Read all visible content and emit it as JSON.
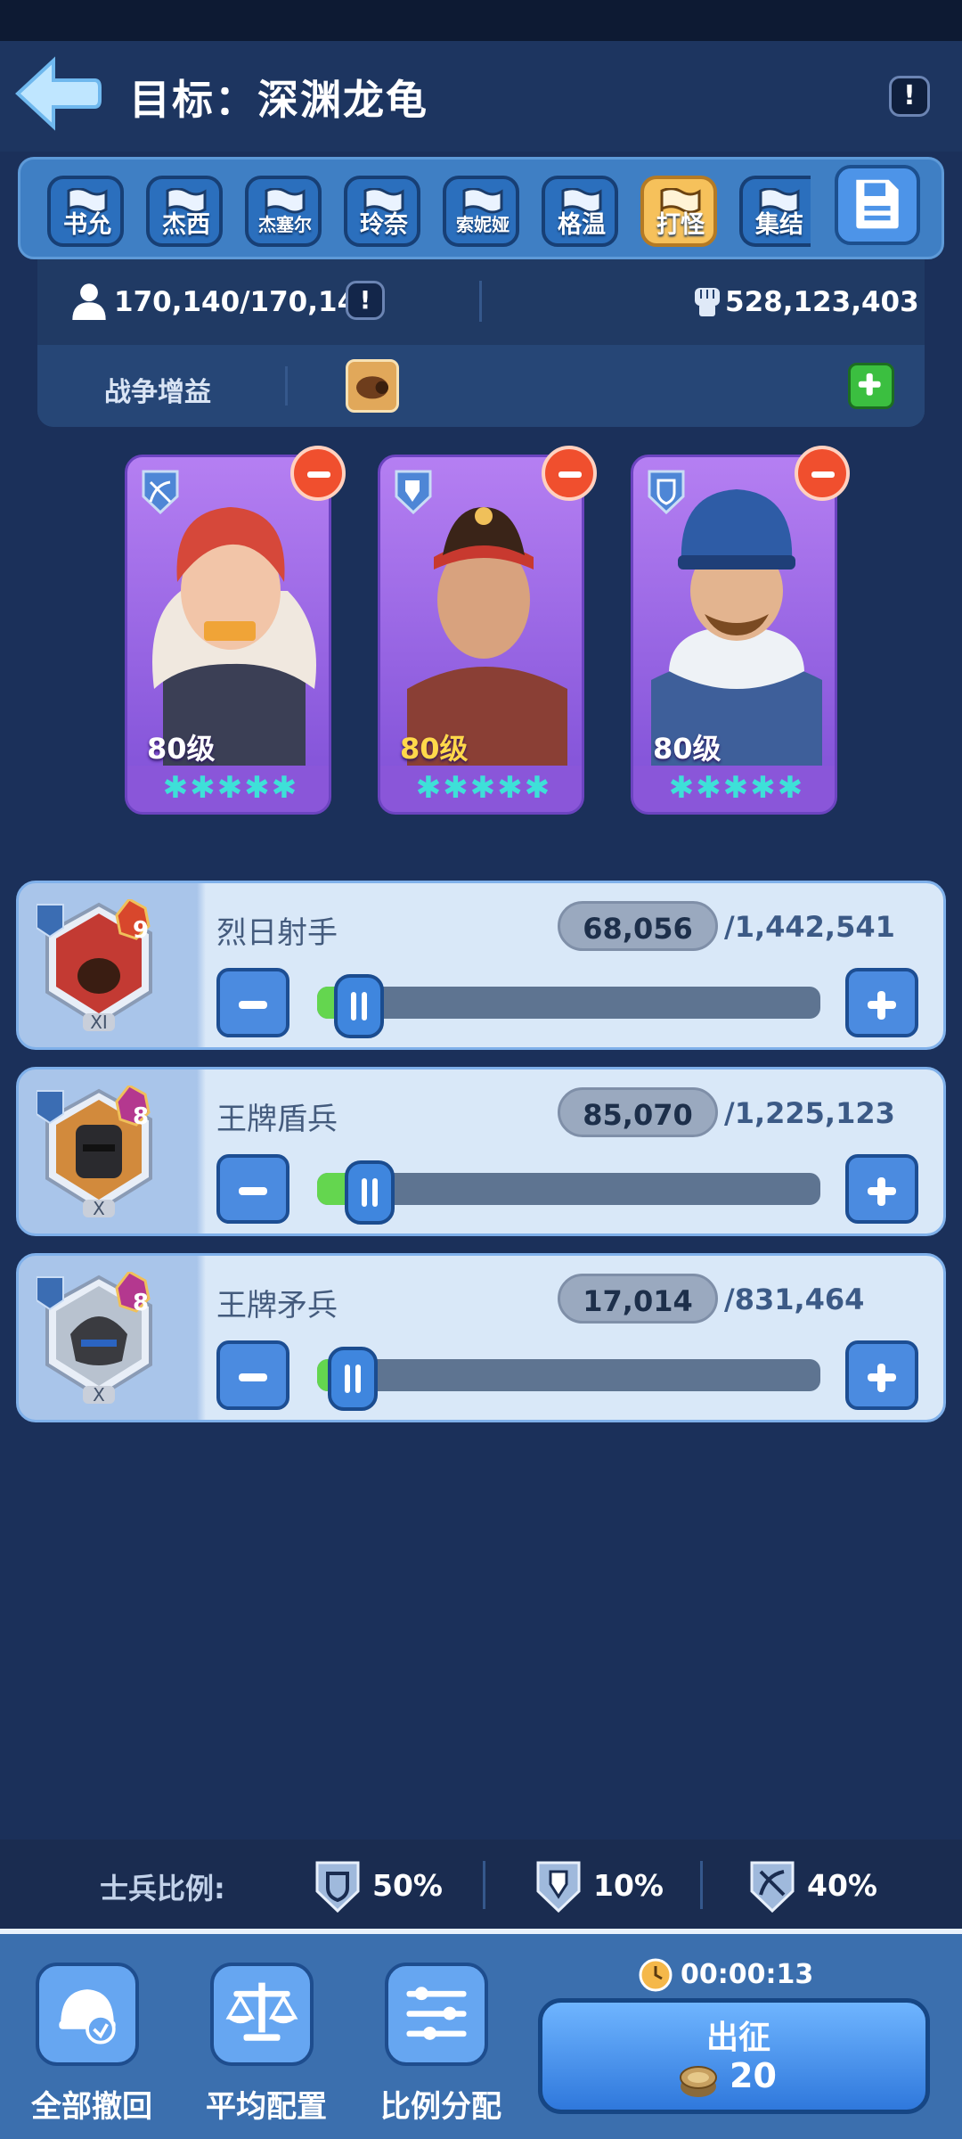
{
  "header": {
    "title": "目标：深渊龙龟",
    "info_icon": "exclamation-icon"
  },
  "presets": [
    {
      "label": "书允",
      "active": false
    },
    {
      "label": "杰西",
      "active": false
    },
    {
      "label": "杰塞尔",
      "active": false
    },
    {
      "label": "玲奈",
      "active": false
    },
    {
      "label": "索妮娅",
      "active": false
    },
    {
      "label": "格温",
      "active": false
    },
    {
      "label": "打怪",
      "active": true
    },
    {
      "label": "集结",
      "active": false
    }
  ],
  "stats": {
    "troops": "170,140/170,140",
    "power": "528,123,403"
  },
  "buff": {
    "label": "战争增益"
  },
  "heroes": [
    {
      "level": "80级",
      "stars": "✱✱✱✱✱",
      "class_icon": "crossbow-icon"
    },
    {
      "level": "80级",
      "stars": "✱✱✱✱✱",
      "class_icon": "spear-icon"
    },
    {
      "level": "80级",
      "stars": "✱✱✱✱✱",
      "class_icon": "shield-icon"
    }
  ],
  "troops": [
    {
      "name": "烈日射手",
      "count": "68,056",
      "max": "/1,442,541",
      "tier": "9",
      "grade": "XI",
      "fill_fraction": 0.047
    },
    {
      "name": "王牌盾兵",
      "count": "85,070",
      "max": "/1,225,123",
      "tier": "8",
      "grade": "X",
      "fill_fraction": 0.069
    },
    {
      "name": "王牌矛兵",
      "count": "17,014",
      "max": "/831,464",
      "tier": "8",
      "grade": "X",
      "fill_fraction": 0.02
    }
  ],
  "ratio": {
    "label": "士兵比例:",
    "shield": "50%",
    "spear": "10%",
    "archer": "40%"
  },
  "actions": {
    "recall_all": "全部撤回",
    "even_config": "平均配置",
    "ratio_assign": "比例分配"
  },
  "march": {
    "label": "出征",
    "cost": "20",
    "timer": "00:00:13"
  },
  "colors": {
    "accent": "#4b8be0",
    "background": "#1b305a",
    "fill_green": "#64d64f",
    "active_preset": "#f6c15b"
  }
}
